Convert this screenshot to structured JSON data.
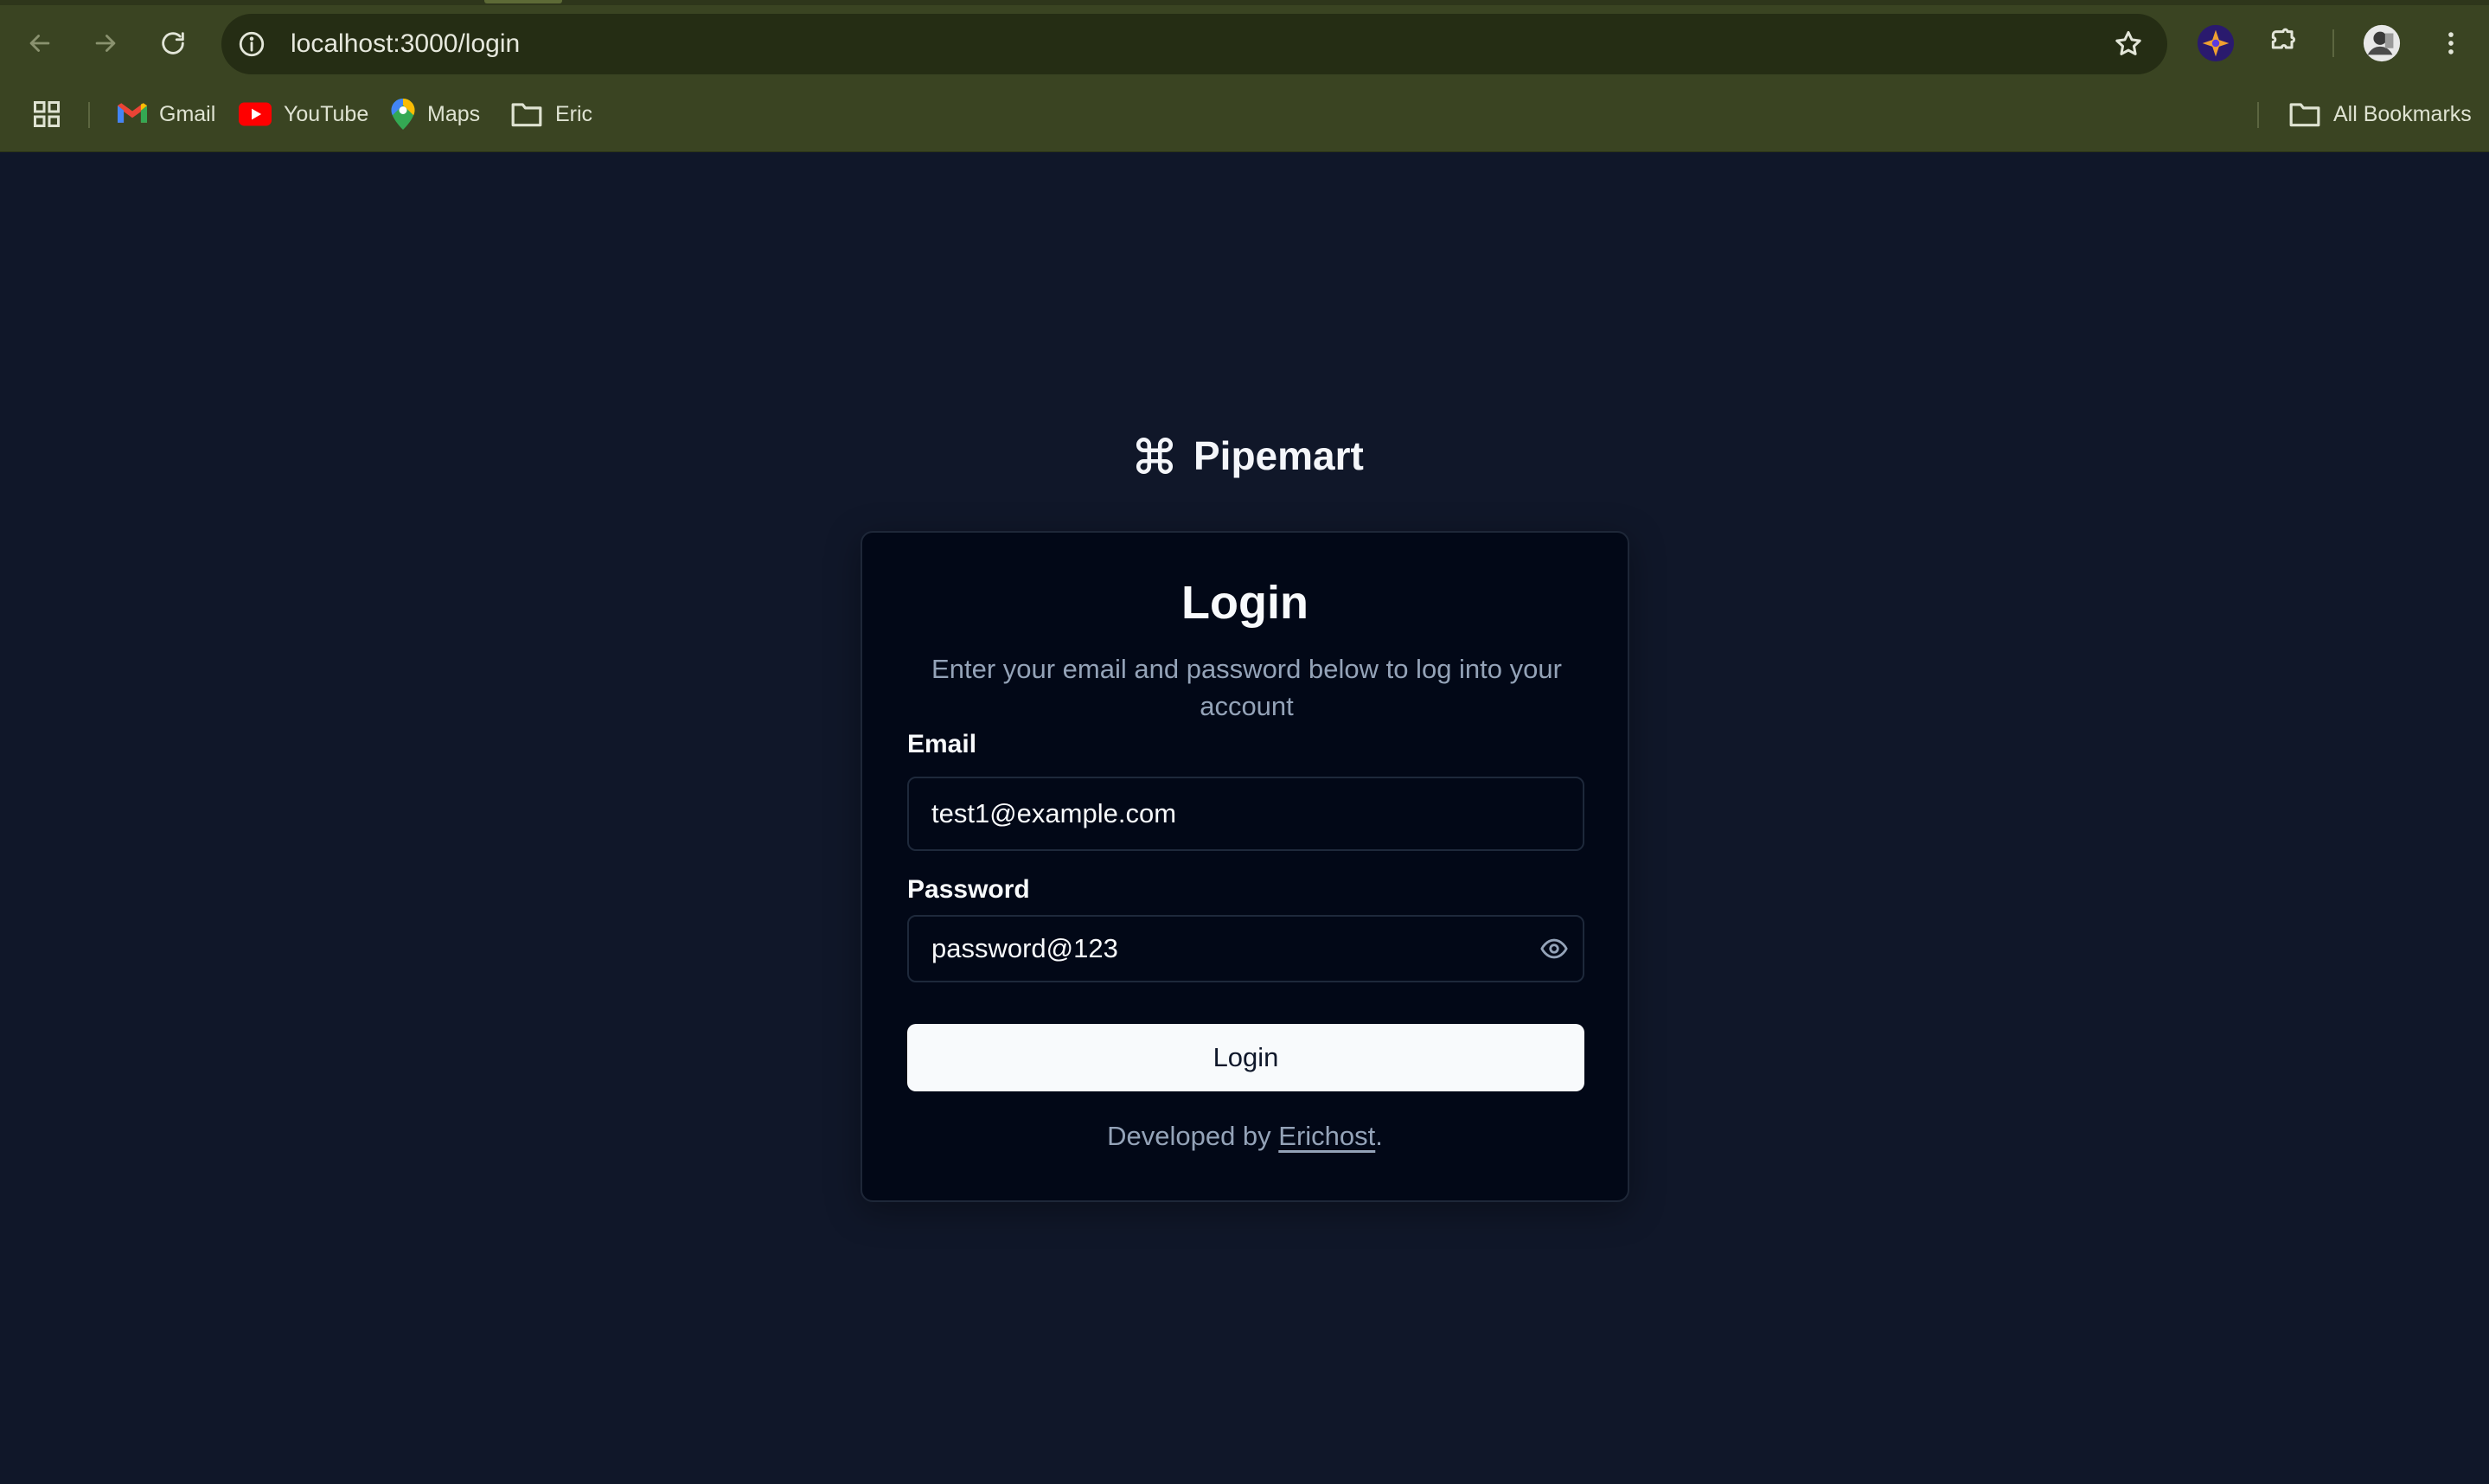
{
  "browser": {
    "url": "localhost:3000/login",
    "bookmarks": [
      {
        "label": "Gmail",
        "icon": "gmail-icon"
      },
      {
        "label": "YouTube",
        "icon": "youtube-icon"
      },
      {
        "label": "Maps",
        "icon": "maps-icon"
      },
      {
        "label": "Eric",
        "icon": "folder-icon"
      }
    ],
    "all_bookmarks_label": "All Bookmarks"
  },
  "brand": {
    "name": "Pipemart",
    "icon": "command-icon"
  },
  "login": {
    "title": "Login",
    "description": "Enter your email and password below to log into your account",
    "email_label": "Email",
    "email_value": "test1@example.com",
    "password_label": "Password",
    "password_value": "password@123",
    "submit_label": "Login",
    "footer_prefix": "Developed by ",
    "footer_link": "Erichost",
    "footer_suffix": "."
  },
  "colors": {
    "page_bg": "#101729",
    "card_bg": "#020817",
    "chrome_bg": "#3a4422",
    "button_bg": "#f8fafc",
    "muted_text": "#94a3b8"
  }
}
